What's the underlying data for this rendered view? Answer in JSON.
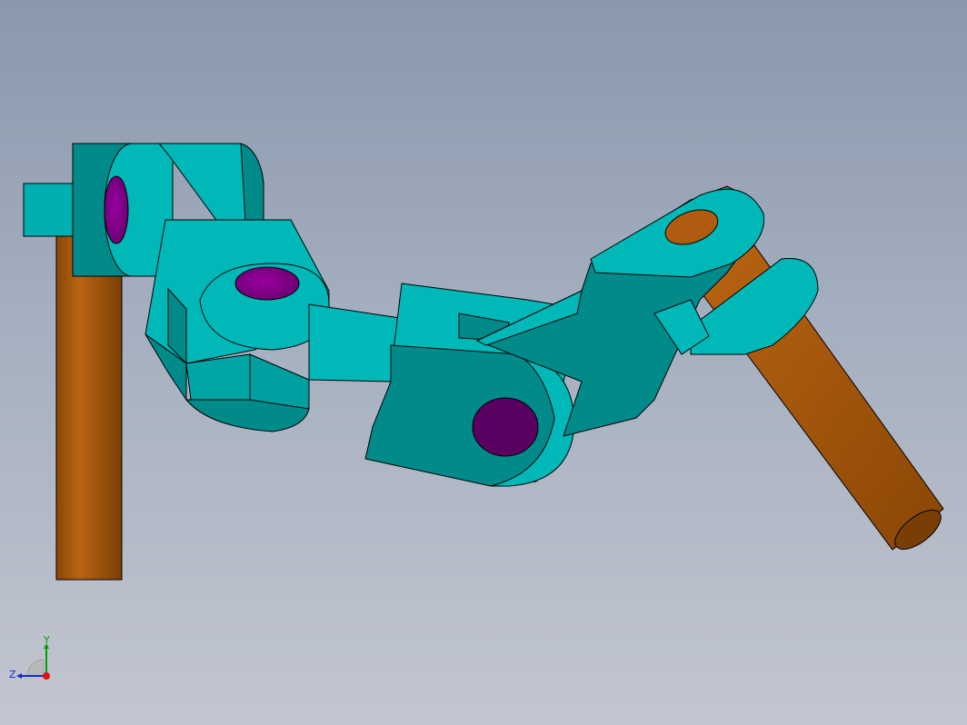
{
  "viewport": {
    "background_top": "#8a98ad",
    "background_bottom": "#c2c6d0"
  },
  "model": {
    "body_color": "#00b8b8",
    "body_shade_color": "#008a8a",
    "shaft_color": "#b06010",
    "shaft_dark_color": "#7a3e05",
    "pin_hole_color": "#8a0090",
    "pin_hole_dark_color": "#5a0060",
    "orange_hole_color": "#b05c10",
    "edge_color": "#000000"
  },
  "triad": {
    "y_label": "Y",
    "z_label": "Z",
    "y_color": "#00a000",
    "z_color": "#1a2ad0",
    "x_color": "#e01010"
  }
}
